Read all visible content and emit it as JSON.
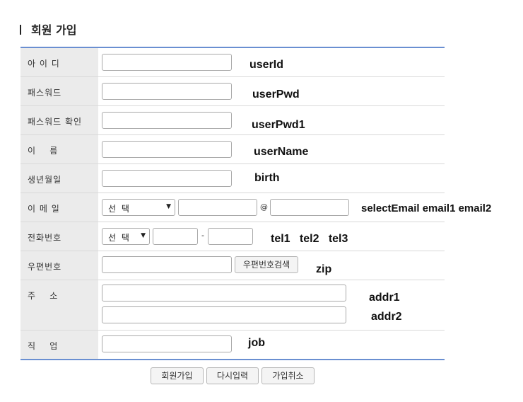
{
  "page": {
    "title": "회원 가입"
  },
  "rows": {
    "userid": {
      "label": "아 이 디",
      "note": "userId"
    },
    "pwd": {
      "label": "패스워드",
      "note": "userPwd"
    },
    "pwd1": {
      "label": "패스워드 확인",
      "note": "userPwd1"
    },
    "name": {
      "label": "이    름",
      "note": "userName"
    },
    "birth": {
      "label": "생년월일",
      "note": "birth"
    },
    "email": {
      "label": "이 메 일",
      "select": "선 택",
      "at": "@",
      "note": "selectEmail email1 email2"
    },
    "tel": {
      "label": "전화번호",
      "select": "선 택",
      "dash": "-",
      "note": "tel1   tel2   tel3"
    },
    "zip": {
      "label": "우편번호",
      "button": "우편번호검색",
      "note": "zip"
    },
    "addr": {
      "label": "주    소",
      "note1": "addr1",
      "note2": "addr2"
    },
    "job": {
      "label": "직    업",
      "note": "job"
    }
  },
  "actions": {
    "submit": "회원가입",
    "reset": "다시입력",
    "cancel": "가입취소"
  }
}
